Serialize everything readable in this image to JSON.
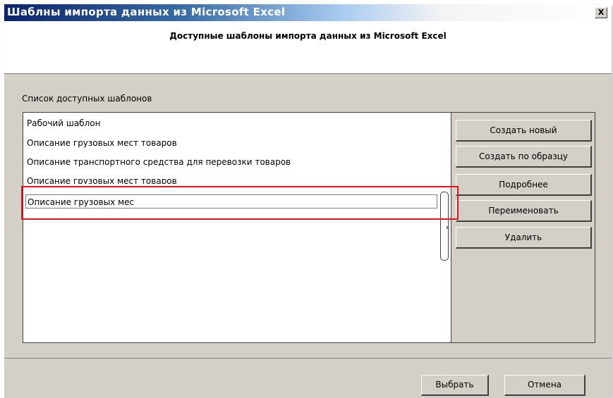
{
  "window": {
    "title": "Шаблны импорта данных из Microsoft Excel",
    "close_label": "X"
  },
  "header": {
    "title": "Доступные шаблоны импорта данных из Microsoft Excel"
  },
  "templates": {
    "label": "Список доступных шаблонов",
    "items": [
      "Рабочий шаблон",
      "Описание грузовых мест товаров",
      "Описание транспортного средства для перевозки товаров",
      "Описание грузовых мест товаров"
    ],
    "edit_value": "Описание грузовых мес"
  },
  "actions": {
    "create_new": "Создать новый",
    "create_from_sample": "Создать по образцу",
    "details": "Подробнее",
    "rename": "Переименовать",
    "delete": "Удалить"
  },
  "footer": {
    "select": "Выбрать",
    "cancel": "Отмена"
  },
  "colors": {
    "highlight": "#e8141c",
    "title_bar": "#0a246a"
  },
  "icons": {
    "close": "close-icon",
    "scroll_arrow": "chevron-right-icon"
  }
}
